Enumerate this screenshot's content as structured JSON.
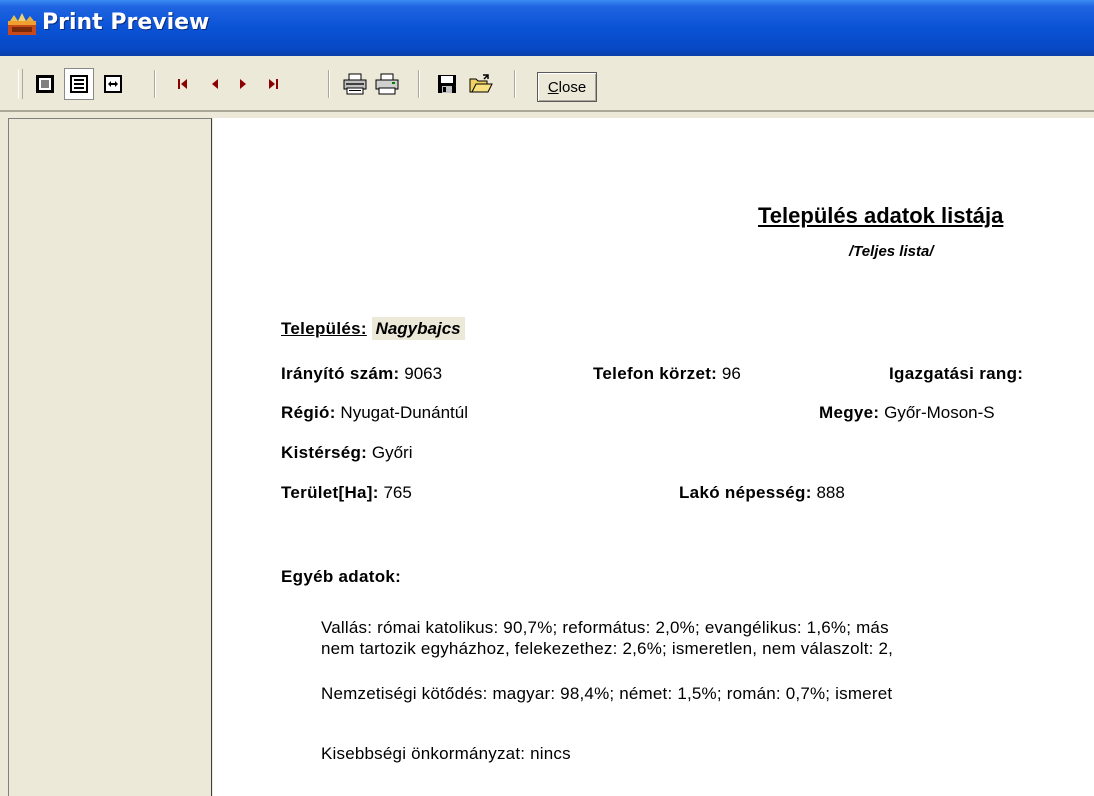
{
  "window": {
    "title": "Print Preview"
  },
  "toolbar": {
    "buttons": [
      {
        "name": "one-page-view-icon"
      },
      {
        "name": "two-page-view-icon"
      },
      {
        "name": "zoom-fit-icon"
      },
      {
        "name": "first-page-icon"
      },
      {
        "name": "previous-page-icon"
      },
      {
        "name": "next-page-icon"
      },
      {
        "name": "last-page-icon"
      },
      {
        "name": "print-setup-icon"
      },
      {
        "name": "print-icon"
      },
      {
        "name": "save-icon"
      },
      {
        "name": "open-icon"
      }
    ],
    "close_first": "C",
    "close_rest": "lose"
  },
  "report": {
    "title": "Település adatok listája",
    "subtitle": "/Teljes lista/",
    "telepules_label": "Település:",
    "telepules_value": "Nagybajcs",
    "iranyito_label": "Irányító szám:",
    "iranyito_value": "9063",
    "telefon_label": "Telefon körzet:",
    "telefon_value": "96",
    "igazgatasi_label": "Igazgatási rang:",
    "regio_label": "Régió:",
    "regio_value": "Nyugat-Dunántúl",
    "megye_label": "Megye:",
    "megye_value": "Győr-Moson-S",
    "kisterseg_label": "Kistérség:",
    "kisterseg_value": "Győri",
    "terulet_label": "Terület[Ha]:",
    "terulet_value": "765",
    "lako_label": "Lakó népesség:",
    "lako_value": "888",
    "egyeb_label": "Egyéb adatok:",
    "vallas_line1": "Vallás: római katolikus: 90,7%; református: 2,0%; evangélikus: 1,6%; más",
    "vallas_line2": "nem tartozik egyházhoz, felekezethez: 2,6%; ismeretlen, nem válaszolt: 2,",
    "nemzetisegi": "Nemzetiségi kötődés: magyar: 98,4%; német: 1,5%; román: 0,7%; ismeret",
    "kisebbsegi": "Kisebbségi önkormányzat: nincs"
  }
}
